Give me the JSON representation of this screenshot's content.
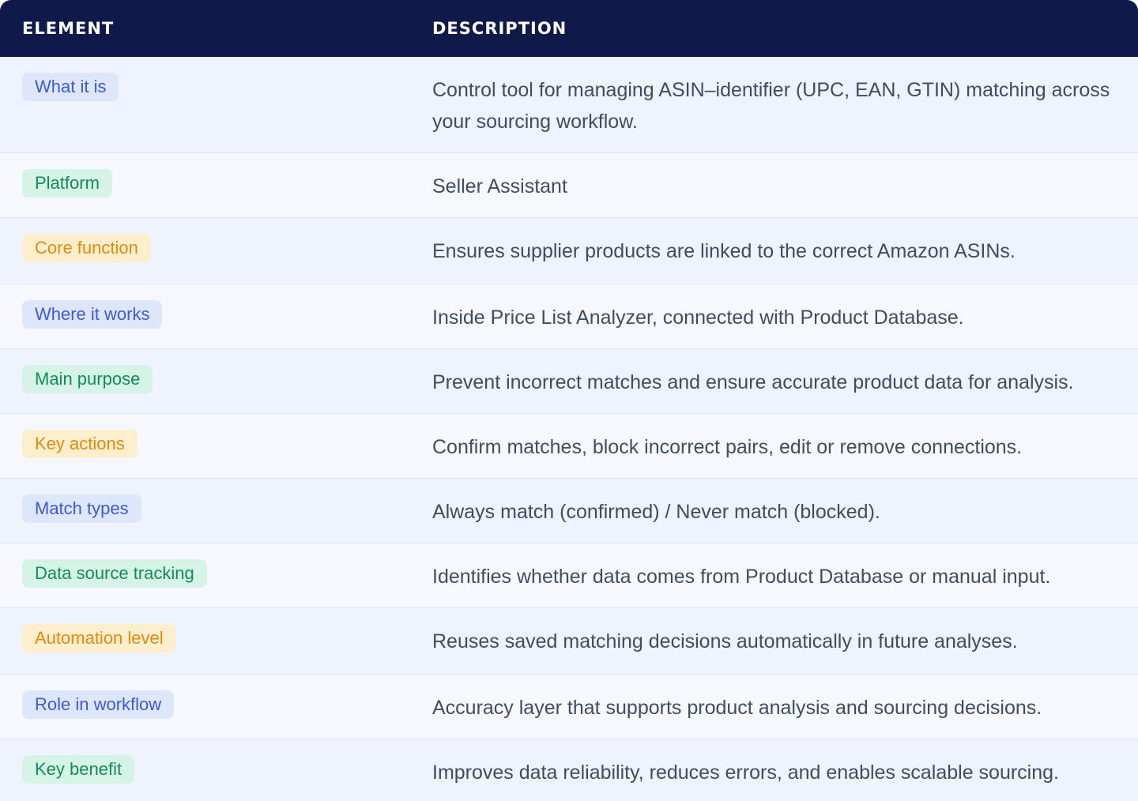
{
  "header": {
    "element_label": "ELEMENT",
    "description_label": "DESCRIPTION"
  },
  "colors": {
    "header_bg": "#0f1a4b",
    "tag_blue_text": "#3d5ad6",
    "tag_green_text": "#158a57",
    "tag_orange_text": "#e08b0b",
    "description_text": "#414c63"
  },
  "rows": [
    {
      "element": "What it is",
      "description": "Control tool for managing ASIN–identifier (UPC, EAN, GTIN) matching across your sourcing workflow."
    },
    {
      "element": "Platform",
      "description": "Seller Assistant"
    },
    {
      "element": "Core function",
      "description": "Ensures supplier products are linked to the correct Amazon ASINs."
    },
    {
      "element": "Where it works",
      "description": "Inside Price List Analyzer, connected with Product Database."
    },
    {
      "element": "Main purpose",
      "description": "Prevent incorrect matches and ensure accurate product data for analysis."
    },
    {
      "element": "Key actions",
      "description": "Confirm matches, block incorrect pairs, edit or remove connections."
    },
    {
      "element": "Match types",
      "description": "Always match (confirmed) / Never match (blocked)."
    },
    {
      "element": "Data source tracking",
      "description": "Identifies whether data comes from Product Database or manual input."
    },
    {
      "element": "Automation level",
      "description": "Reuses saved matching decisions automatically in future analyses."
    },
    {
      "element": "Role in workflow",
      "description": "Accuracy layer that supports product analysis and sourcing decisions."
    },
    {
      "element": "Key benefit",
      "description": "Improves data reliability, reduces errors, and enables scalable sourcing."
    }
  ]
}
